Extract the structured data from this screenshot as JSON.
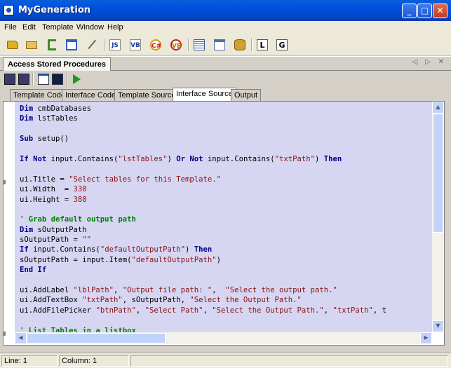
{
  "window": {
    "title": "MyGeneration",
    "minimize": "_",
    "maximize": "□",
    "close": "✕"
  },
  "menu": [
    "File",
    "Edit",
    "Template",
    "Window",
    "Help"
  ],
  "toolbar": {
    "items": [
      {
        "icon": "open-folder-icon",
        "color": "#e0b020"
      },
      {
        "icon": "folder-new-icon",
        "color": "#d9a43c"
      },
      {
        "icon": "tree-view-icon",
        "color": "#3a8c2a"
      },
      {
        "icon": "window-icon",
        "color": "#3460c0"
      },
      {
        "icon": "pin-icon",
        "color": "#6a6a6a"
      },
      {
        "icon": "js-template-icon",
        "text": "JS",
        "color": "#20409a"
      },
      {
        "icon": "vb-template-icon",
        "text": "VB",
        "color": "#20409a"
      },
      {
        "icon": "csharp-template-icon",
        "text": "C#",
        "color": "#c02020"
      },
      {
        "icon": "vbnet-template-icon",
        "text": "VB",
        "color": "#c07000"
      },
      {
        "icon": "properties-icon",
        "color": "#4060a0"
      },
      {
        "icon": "dialog-icon",
        "color": "#5070b0"
      },
      {
        "icon": "database-icon",
        "color": "#d0a030"
      },
      {
        "icon": "language-mapping-icon",
        "text": "L",
        "color": "#000000"
      },
      {
        "icon": "global-user-meta-icon",
        "text": "G",
        "color": "#000000"
      }
    ]
  },
  "document": {
    "tab_title": "Access Stored Procedures",
    "nav": "◁ ▷ ✕"
  },
  "subtoolbar": {
    "items": [
      {
        "icon": "save-icon"
      },
      {
        "icon": "save-as-icon"
      },
      {
        "icon": "console-icon"
      },
      {
        "icon": "terminal-icon"
      },
      {
        "icon": "run-icon",
        "color": "#1a9a1a"
      }
    ]
  },
  "tabs": [
    "Template Code",
    "Interface Code",
    "Template Source",
    "Interface Source",
    "Output"
  ],
  "active_tab": 3,
  "editor": {
    "lines": [
      [
        [
          "kw",
          "Dim "
        ],
        [
          "t",
          "cmbDatabases"
        ]
      ],
      [
        [
          "kw",
          "Dim "
        ],
        [
          "t",
          "lstTables"
        ]
      ],
      [],
      [
        [
          "kw",
          "Sub "
        ],
        [
          "t",
          "setup()"
        ]
      ],
      [],
      [
        [
          "kw",
          "If Not "
        ],
        [
          "t",
          "input.Contains("
        ],
        [
          "str",
          "\"lstTables\""
        ],
        [
          "t",
          ") "
        ],
        [
          "kw",
          "Or Not "
        ],
        [
          "t",
          "input.Contains("
        ],
        [
          "str",
          "\"txtPath\""
        ],
        [
          "t",
          ") "
        ],
        [
          "kw",
          "Then"
        ]
      ],
      [],
      [
        [
          "t",
          "ui.Title = "
        ],
        [
          "str",
          "\"Select tables for this Template.\""
        ]
      ],
      [
        [
          "t",
          "ui.Width  = "
        ],
        [
          "num",
          "330"
        ]
      ],
      [
        [
          "t",
          "ui.Height = "
        ],
        [
          "num",
          "380"
        ]
      ],
      [],
      [
        [
          "cm",
          "' Grab default output path"
        ]
      ],
      [
        [
          "kw",
          "Dim "
        ],
        [
          "t",
          "sOutputPath"
        ]
      ],
      [
        [
          "t",
          "sOutputPath = "
        ],
        [
          "str",
          "\"\""
        ]
      ],
      [
        [
          "kw",
          "If "
        ],
        [
          "t",
          "input.Contains("
        ],
        [
          "str",
          "\"defaultOutputPath\""
        ],
        [
          "t",
          ") "
        ],
        [
          "kw",
          "Then"
        ]
      ],
      [
        [
          "t",
          "sOutputPath = input.Item("
        ],
        [
          "str",
          "\"defaultOutputPath\""
        ],
        [
          "t",
          ")"
        ]
      ],
      [
        [
          "kw",
          "End If"
        ]
      ],
      [],
      [
        [
          "t",
          "ui.AddLabel "
        ],
        [
          "str",
          "\"lblPath\""
        ],
        [
          "t",
          ", "
        ],
        [
          "str",
          "\"Output file path: \""
        ],
        [
          "t",
          ",  "
        ],
        [
          "str",
          "\"Select the output path.\""
        ]
      ],
      [
        [
          "t",
          "ui.AddTextBox "
        ],
        [
          "str",
          "\"txtPath\""
        ],
        [
          "t",
          ", sOutputPath, "
        ],
        [
          "str",
          "\"Select the Output Path.\""
        ]
      ],
      [
        [
          "t",
          "ui.AddFilePicker "
        ],
        [
          "str",
          "\"btnPath\""
        ],
        [
          "t",
          ", "
        ],
        [
          "str",
          "\"Select Path\""
        ],
        [
          "t",
          ", "
        ],
        [
          "str",
          "\"Select the Output Path.\""
        ],
        [
          "t",
          ", "
        ],
        [
          "str",
          "\"txtPath\""
        ],
        [
          "t",
          ", t"
        ]
      ],
      [],
      [
        [
          "cm",
          "' List Tables in a listbox"
        ]
      ]
    ]
  },
  "scrollbar": {
    "up": "▲",
    "down": "▼",
    "left": "◀",
    "right": "▶"
  },
  "status": {
    "line": "Line: 1",
    "column": "Column: 1"
  }
}
